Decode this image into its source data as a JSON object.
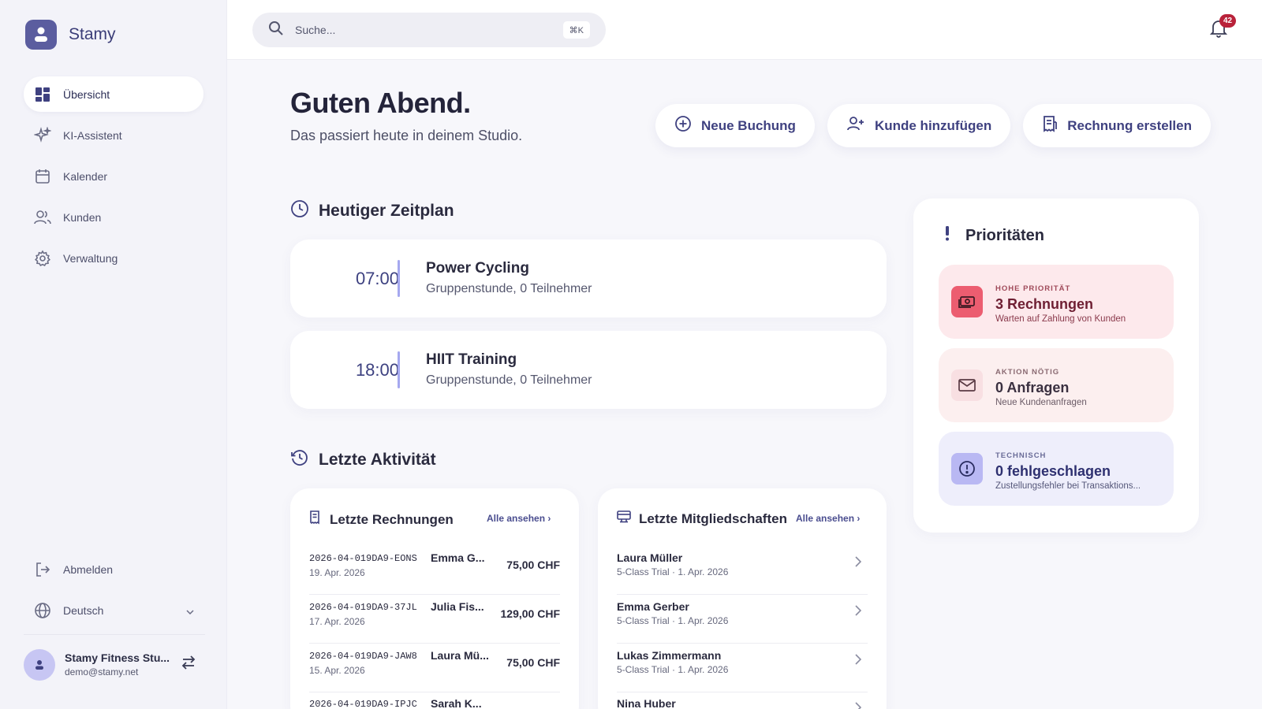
{
  "brand": {
    "name": "Stamy"
  },
  "sidebar": {
    "items": [
      {
        "label": "Übersicht",
        "icon": "dashboard-icon",
        "active": true
      },
      {
        "label": "KI-Assistent",
        "icon": "sparkles-icon",
        "active": false
      },
      {
        "label": "Kalender",
        "icon": "calendar-icon",
        "active": false
      },
      {
        "label": "Kunden",
        "icon": "users-icon",
        "active": false
      },
      {
        "label": "Verwaltung",
        "icon": "gear-icon",
        "active": false
      }
    ],
    "logout_label": "Abmelden",
    "language_label": "Deutsch",
    "user": {
      "name": "Stamy Fitness Stu...",
      "email": "demo@stamy.net"
    }
  },
  "search": {
    "placeholder": "Suche...",
    "shortcut": "⌘K"
  },
  "notifications": {
    "count": "42"
  },
  "main": {
    "greeting": "Guten Abend.",
    "subline": "Das passiert heute in deinem Studio.",
    "actions": {
      "new_booking": "Neue Buchung",
      "add_customer": "Kunde hinzufügen",
      "create_invoice": "Rechnung erstellen"
    },
    "schedule_title": "Heutiger Zeitplan",
    "schedule": [
      {
        "time": "07:00",
        "title": "Power Cycling",
        "subtitle": "Gruppenstunde, 0 Teilnehmer"
      },
      {
        "time": "18:00",
        "title": "HIIT Training",
        "subtitle": "Gruppenstunde, 0 Teilnehmer"
      }
    ],
    "activity_title": "Letzte Aktivität",
    "invoices": {
      "title": "Letzte Rechnungen",
      "link": "Alle ansehen",
      "rows": [
        {
          "id": "2026-04-019DA9-EONS",
          "name": "Emma G...",
          "date": "19. Apr. 2026",
          "amount": "75,00 CHF"
        },
        {
          "id": "2026-04-019DA9-37JL",
          "name": "Julia Fis...",
          "date": "17. Apr. 2026",
          "amount": "129,00 CHF"
        },
        {
          "id": "2026-04-019DA9-JAW8",
          "name": "Laura Mü...",
          "date": "15. Apr. 2026",
          "amount": "75,00 CHF"
        },
        {
          "id": "2026-04-019DA9-IPJC",
          "name": "Sarah K...",
          "date": "",
          "amount": ""
        }
      ]
    },
    "memberships": {
      "title": "Letzte Mitgliedschaften",
      "link": "Alle ansehen",
      "rows": [
        {
          "name": "Laura Müller",
          "sub": "5-Class Trial · 1. Apr. 2026"
        },
        {
          "name": "Emma Gerber",
          "sub": "5-Class Trial · 1. Apr. 2026"
        },
        {
          "name": "Lukas Zimmermann",
          "sub": "5-Class Trial · 1. Apr. 2026"
        },
        {
          "name": "Nina Huber",
          "sub": ""
        }
      ]
    }
  },
  "priorities": {
    "title": "Prioritäten",
    "cards": [
      {
        "kicker": "HOHE PRIORITÄT",
        "value": "3 Rechnungen",
        "desc": "Warten auf Zahlung von Kunden",
        "icon": "money-icon"
      },
      {
        "kicker": "AKTION NÖTIG",
        "value": "0 Anfragen",
        "desc": "Neue Kundenanfragen",
        "icon": "mail-icon"
      },
      {
        "kicker": "TECHNISCH",
        "value": "0 fehlgeschlagen",
        "desc": "Zustellungsfehler bei Transaktions...",
        "icon": "alert-circle-icon"
      }
    ]
  },
  "colors": {
    "accent": "#3f4180",
    "brand_logo": "#5b5d9f",
    "badge": "#b9223a",
    "high_priority_bg": "#fde9ec",
    "high_priority_icon": "#ec5d70",
    "action_bg": "#fcefef",
    "technical_bg": "#eeeefb",
    "technical_icon": "#b9b8f3"
  }
}
